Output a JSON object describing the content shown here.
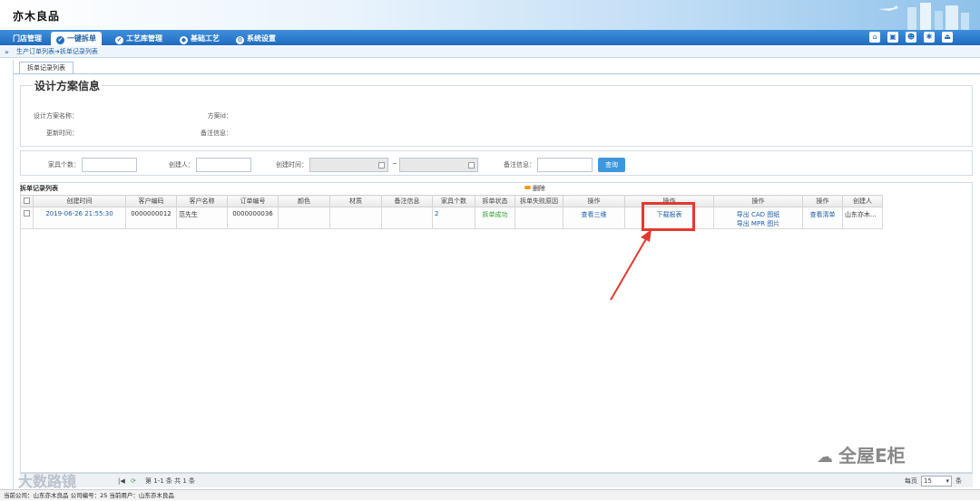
{
  "app": {
    "logo": "亦木良品"
  },
  "nav": {
    "tabs": [
      {
        "label": "门店管理",
        "icon": ""
      },
      {
        "label": "一键拆单",
        "icon": "✔"
      },
      {
        "label": "工艺库管理",
        "icon": "✔"
      },
      {
        "label": "基础工艺",
        "icon": "◆"
      },
      {
        "label": "系统设置",
        "icon": "⚙"
      }
    ],
    "right_icons": [
      "home-icon",
      "save-icon",
      "user-icon",
      "gear-icon",
      "exit-icon"
    ]
  },
  "breadcrumb": {
    "items": [
      "生产订单列表",
      "拆单记录列表"
    ],
    "sep": "➔"
  },
  "page_tab": "拆单记录列表",
  "design": {
    "title": "设计方案信息",
    "fields": [
      {
        "label": "设计方案名称：",
        "value": ""
      },
      {
        "label": "方案id：",
        "value": ""
      },
      {
        "label": "更新时间：",
        "value": ""
      },
      {
        "label": "备注信息：",
        "value": ""
      }
    ]
  },
  "filters": {
    "furniture_count": "家具个数：",
    "creator": "创建人：",
    "created_time": "创建时间：",
    "range_sep": "~",
    "remark": "备注信息：",
    "query": "查询"
  },
  "grid": {
    "title": "拆单记录列表",
    "delete": "删除",
    "columns": [
      "",
      "创建时间",
      "客户编码",
      "客户名称",
      "订单编号",
      "颜色",
      "材质",
      "备注信息",
      "家具个数",
      "拆单状态",
      "拆单失败原因",
      "操作",
      "操作",
      "操作",
      "操作",
      "创建人"
    ],
    "rows": [
      {
        "created": "2019-06-26 21:55:30",
        "customer_code": "0000000012",
        "customer_name": "范先生",
        "order_no": "0000000036",
        "color": "",
        "material": "",
        "remark": "",
        "count": "2",
        "status": "拆单成功",
        "fail_reason": "",
        "op1": "查看三维",
        "op2": "下载报表",
        "op3a": "导出 CAD 图纸",
        "op3b": "导出 MPR 图片",
        "op4": "查看清单",
        "creator": "山东亦木..."
      }
    ]
  },
  "pager": {
    "info": "第 1-1 条  共 1 条",
    "per_page": "每页",
    "per_page_value": "15",
    "unit": "条"
  },
  "status_bar": "当前公司：山东亦木良品   公司编号：25   当前用户：山东亦木良品",
  "watermark": "全屋E柜",
  "watermark2": "大数路镜"
}
